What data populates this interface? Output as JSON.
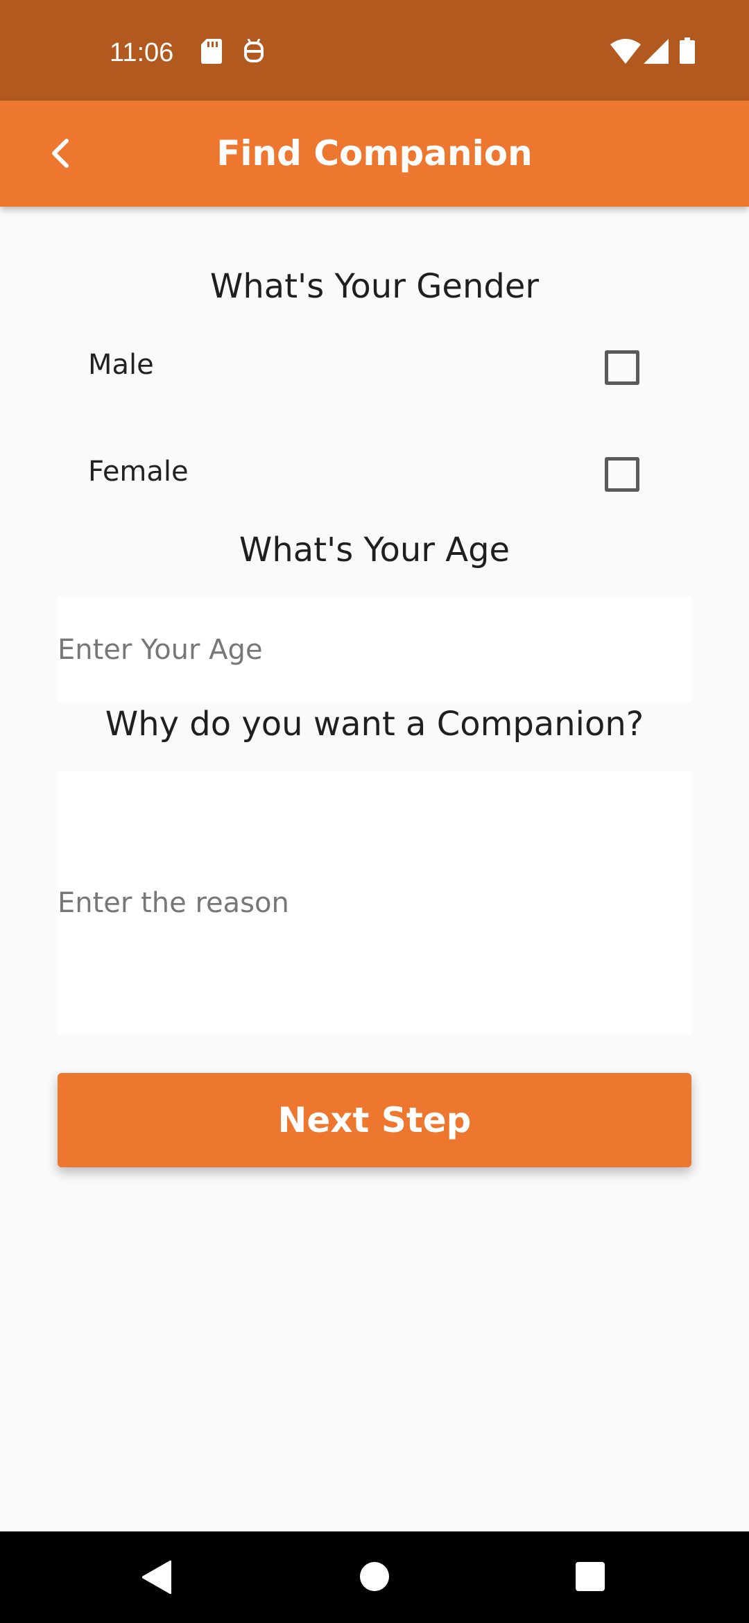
{
  "status_bar": {
    "time": "11:06",
    "icons": [
      "sd-card-icon",
      "android-debug-icon",
      "wifi-icon",
      "signal-icon",
      "battery-icon"
    ]
  },
  "app_bar": {
    "title": "Find Companion",
    "back_icon": "chevron-left-icon",
    "color": "#ee772f"
  },
  "gender": {
    "heading": "What's Your Gender",
    "options": [
      {
        "label": "Male",
        "checked": false
      },
      {
        "label": "Female",
        "checked": false
      }
    ]
  },
  "age": {
    "heading": "What's Your Age",
    "placeholder": "Enter Your Age",
    "value": ""
  },
  "reason": {
    "heading": "Why do you want a Companion?",
    "placeholder": "Enter the reason",
    "value": ""
  },
  "next_button": {
    "label": "Next Step"
  },
  "nav_bar": {
    "icons": [
      "back-triangle-icon",
      "home-circle-icon",
      "recents-square-icon"
    ]
  },
  "colors": {
    "accent": "#ee772f",
    "status_bar": "#b25920",
    "background": "#fafafa"
  }
}
